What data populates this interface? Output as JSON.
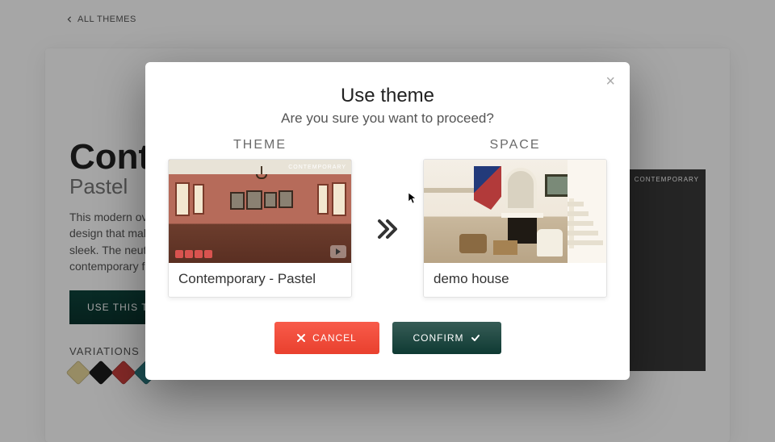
{
  "nav": {
    "back_label": "ALL THEMES"
  },
  "theme": {
    "title": "Contemporary",
    "subtitle": "Pastel",
    "description": "This modern overlay offers a clean and minimalistic design that makes your space look professional and sleek. The neutral-colored elements give it that contemporary feel.",
    "use_button": "USE THIS THEME",
    "variations_label": "VARIATIONS",
    "swatches": [
      "#e8d79a",
      "#1c1c1c",
      "#c9403d",
      "#2a7a80"
    ],
    "preview_tag": "CONTEMPORARY"
  },
  "modal": {
    "title": "Use theme",
    "subtitle": "Are you sure you want to proceed?",
    "theme_col_label": "THEME",
    "space_col_label": "SPACE",
    "theme_name": "Contemporary - Pastel",
    "theme_tag": "CONTEMPORARY",
    "space_name": "demo house",
    "cancel_label": "CANCEL",
    "confirm_label": "CONFIRM"
  }
}
